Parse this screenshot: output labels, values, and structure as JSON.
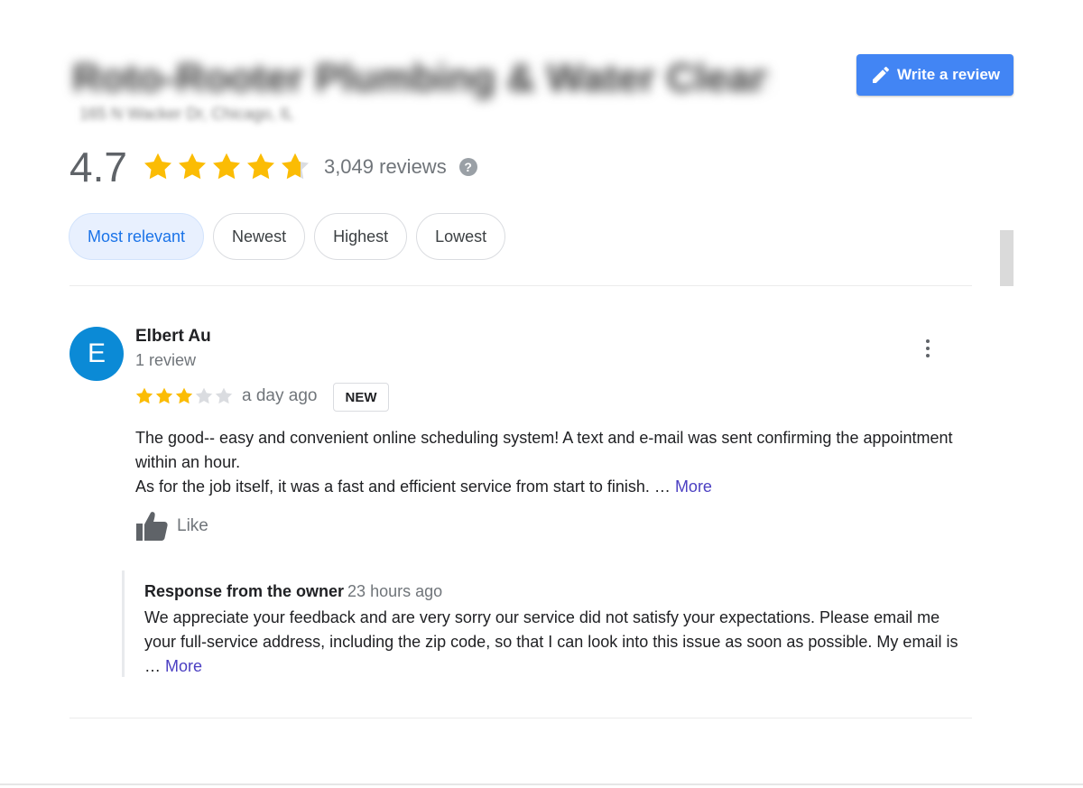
{
  "header": {
    "business_name": "Roto-Rooter Plumbing & Water Cleanup",
    "address": "165 N Wacker Dr, Chicago, IL",
    "write_review_label": "Write a review"
  },
  "summary": {
    "rating": "4.7",
    "rating_value": 4.7,
    "review_count": "3,049 reviews",
    "help_symbol": "?"
  },
  "sort_chips": [
    {
      "label": "Most relevant",
      "active": true
    },
    {
      "label": "Newest",
      "active": false
    },
    {
      "label": "Highest",
      "active": false
    },
    {
      "label": "Lowest",
      "active": false
    }
  ],
  "review": {
    "avatar_initial": "E",
    "avatar_color": "#0b8ad6",
    "author": "Elbert Au",
    "author_meta": "1 review",
    "stars": 3,
    "time": "a day ago",
    "badge": "NEW",
    "text_line1": "The good-- easy and convenient online scheduling system! A text and e-mail was sent confirming the appointment within an hour.",
    "text_line2": "As for the job itself, it was a fast and efficient service from start to finish. …",
    "more_label": "More",
    "like_label": "Like"
  },
  "owner_response": {
    "title": "Response from the owner",
    "time": "23 hours ago",
    "text": "We appreciate your feedback and are very sorry our service did not satisfy your expectations. Please email me your full-service address, including the zip code, so that I can look into this issue as soon as possible. My email is …",
    "more_label": "More"
  },
  "colors": {
    "star_filled": "#fbbc04",
    "star_empty": "#dadce0",
    "accent": "#4285f4",
    "link": "#4b3fc2"
  }
}
